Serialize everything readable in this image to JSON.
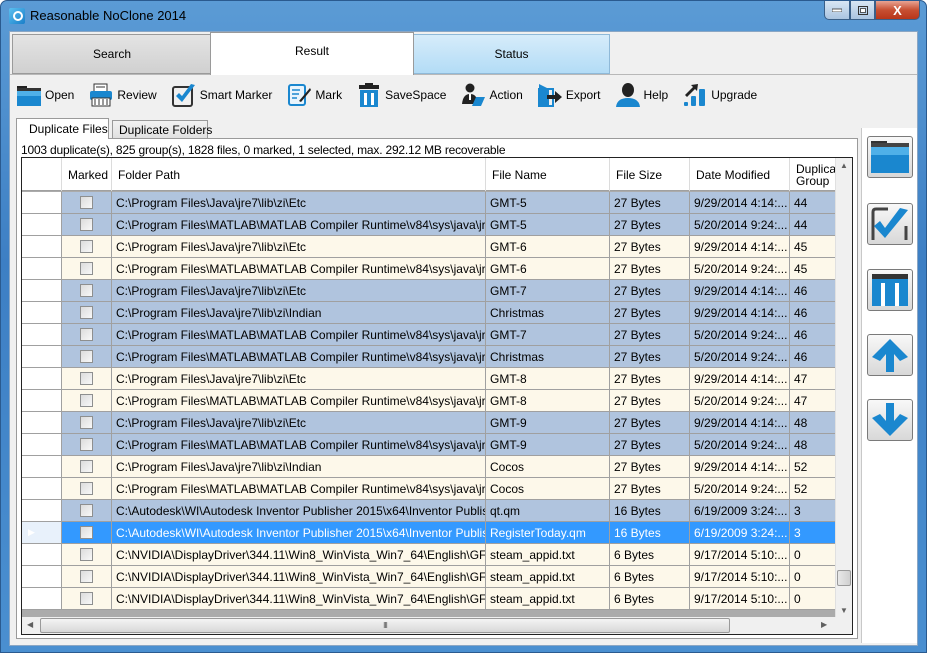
{
  "window": {
    "title": "Reasonable NoClone  2014",
    "controls": {
      "minimize": "—",
      "maximize": "▫",
      "close": "X"
    }
  },
  "main_tabs": [
    {
      "label": "Search",
      "active": false
    },
    {
      "label": "Result",
      "active": true
    },
    {
      "label": "Status",
      "active": false
    }
  ],
  "toolbar": [
    {
      "label": "Open",
      "icon": "folder-icon"
    },
    {
      "label": "Review",
      "icon": "review-icon"
    },
    {
      "label": "Smart Marker",
      "icon": "checkmark-icon"
    },
    {
      "label": "Mark",
      "icon": "pen-icon"
    },
    {
      "label": "SaveSpace",
      "icon": "trash-icon"
    },
    {
      "label": "Action",
      "icon": "person-laptop-icon"
    },
    {
      "label": "Export",
      "icon": "export-icon"
    },
    {
      "label": "Help",
      "icon": "person-icon"
    },
    {
      "label": "Upgrade",
      "icon": "upgrade-icon"
    }
  ],
  "sub_tabs": [
    {
      "label": "Duplicate Files",
      "active": true
    },
    {
      "label": "Duplicate Folders",
      "active": false
    }
  ],
  "summary": "1003 duplicate(s), 825 group(s), 1828 files, 0 marked, 1 selected, max. 292.12 MB recoverable",
  "grid": {
    "columns": [
      "Marked",
      "Folder Path",
      "File Name",
      "File Size",
      "Date Modified",
      "Duplica Group"
    ],
    "rows": [
      {
        "style": "blue",
        "marked": false,
        "folder": "C:\\Program Files\\Java\\jre7\\lib\\zi\\Etc",
        "name": "GMT-5",
        "size": "27 Bytes",
        "date": "9/29/2014 4:14:...",
        "group": "44"
      },
      {
        "style": "blue",
        "marked": false,
        "folder": "C:\\Program Files\\MATLAB\\MATLAB Compiler Runtime\\v84\\sys\\java\\jre\\w...",
        "name": "GMT-5",
        "size": "27 Bytes",
        "date": "5/20/2014 9:24:...",
        "group": "44"
      },
      {
        "style": "cream",
        "marked": false,
        "folder": "C:\\Program Files\\Java\\jre7\\lib\\zi\\Etc",
        "name": "GMT-6",
        "size": "27 Bytes",
        "date": "9/29/2014 4:14:...",
        "group": "45"
      },
      {
        "style": "cream",
        "marked": false,
        "folder": "C:\\Program Files\\MATLAB\\MATLAB Compiler Runtime\\v84\\sys\\java\\jre\\w...",
        "name": "GMT-6",
        "size": "27 Bytes",
        "date": "5/20/2014 9:24:...",
        "group": "45"
      },
      {
        "style": "blue",
        "marked": false,
        "folder": "C:\\Program Files\\Java\\jre7\\lib\\zi\\Etc",
        "name": "GMT-7",
        "size": "27 Bytes",
        "date": "9/29/2014 4:14:...",
        "group": "46"
      },
      {
        "style": "blue",
        "marked": false,
        "folder": "C:\\Program Files\\Java\\jre7\\lib\\zi\\Indian",
        "name": "Christmas",
        "size": "27 Bytes",
        "date": "9/29/2014 4:14:...",
        "group": "46"
      },
      {
        "style": "blue",
        "marked": false,
        "folder": "C:\\Program Files\\MATLAB\\MATLAB Compiler Runtime\\v84\\sys\\java\\jre\\w...",
        "name": "GMT-7",
        "size": "27 Bytes",
        "date": "5/20/2014 9:24:...",
        "group": "46"
      },
      {
        "style": "blue",
        "marked": false,
        "folder": "C:\\Program Files\\MATLAB\\MATLAB Compiler Runtime\\v84\\sys\\java\\jre\\w...",
        "name": "Christmas",
        "size": "27 Bytes",
        "date": "5/20/2014 9:24:...",
        "group": "46"
      },
      {
        "style": "cream",
        "marked": false,
        "folder": "C:\\Program Files\\Java\\jre7\\lib\\zi\\Etc",
        "name": "GMT-8",
        "size": "27 Bytes",
        "date": "9/29/2014 4:14:...",
        "group": "47"
      },
      {
        "style": "cream",
        "marked": false,
        "folder": "C:\\Program Files\\MATLAB\\MATLAB Compiler Runtime\\v84\\sys\\java\\jre\\w...",
        "name": "GMT-8",
        "size": "27 Bytes",
        "date": "5/20/2014 9:24:...",
        "group": "47"
      },
      {
        "style": "blue",
        "marked": false,
        "folder": "C:\\Program Files\\Java\\jre7\\lib\\zi\\Etc",
        "name": "GMT-9",
        "size": "27 Bytes",
        "date": "9/29/2014 4:14:...",
        "group": "48"
      },
      {
        "style": "blue",
        "marked": false,
        "folder": "C:\\Program Files\\MATLAB\\MATLAB Compiler Runtime\\v84\\sys\\java\\jre\\w...",
        "name": "GMT-9",
        "size": "27 Bytes",
        "date": "5/20/2014 9:24:...",
        "group": "48"
      },
      {
        "style": "cream",
        "marked": false,
        "folder": "C:\\Program Files\\Java\\jre7\\lib\\zi\\Indian",
        "name": "Cocos",
        "size": "27 Bytes",
        "date": "9/29/2014 4:14:...",
        "group": "52"
      },
      {
        "style": "cream",
        "marked": false,
        "folder": "C:\\Program Files\\MATLAB\\MATLAB Compiler Runtime\\v84\\sys\\java\\jre\\w...",
        "name": "Cocos",
        "size": "27 Bytes",
        "date": "5/20/2014 9:24:...",
        "group": "52"
      },
      {
        "style": "blue",
        "marked": false,
        "folder": "C:\\Autodesk\\WI\\Autodesk Inventor Publisher 2015\\x64\\Inventor Publisher...",
        "name": "qt.qm",
        "size": "16 Bytes",
        "date": "6/19/2009 3:24:...",
        "group": "3"
      },
      {
        "style": "sel",
        "marked": false,
        "current": true,
        "folder": "C:\\Autodesk\\WI\\Autodesk Inventor Publisher 2015\\x64\\Inventor Publisher...",
        "name": "RegisterToday.qm",
        "size": "16 Bytes",
        "date": "6/19/2009 3:24:...",
        "group": "3"
      },
      {
        "style": "cream",
        "marked": false,
        "folder": "C:\\NVIDIA\\DisplayDriver\\344.11\\Win8_WinVista_Win7_64\\English\\GFEx...",
        "name": "steam_appid.txt",
        "size": "6 Bytes",
        "date": "9/17/2014 5:10:...",
        "group": "0"
      },
      {
        "style": "cream",
        "marked": false,
        "folder": "C:\\NVIDIA\\DisplayDriver\\344.11\\Win8_WinVista_Win7_64\\English\\GFEx...",
        "name": "steam_appid.txt",
        "size": "6 Bytes",
        "date": "9/17/2014 5:10:...",
        "group": "0"
      },
      {
        "style": "cream",
        "marked": false,
        "folder": "C:\\NVIDIA\\DisplayDriver\\344.11\\Win8_WinVista_Win7_64\\English\\GFEx...",
        "name": "steam_appid.txt",
        "size": "6 Bytes",
        "date": "9/17/2014 5:10:...",
        "group": "0"
      }
    ]
  },
  "scrollbars": {
    "hscroll_grip": "III",
    "current_row_marker": "▶"
  },
  "side_buttons": [
    {
      "name": "open-folder",
      "icon": "folder-icon"
    },
    {
      "name": "smart-marker",
      "icon": "checkmark-icon"
    },
    {
      "name": "savespace",
      "icon": "trash-icon"
    },
    {
      "name": "move-up",
      "icon": "arrow-up-icon"
    },
    {
      "name": "move-down",
      "icon": "arrow-down-icon"
    }
  ],
  "colors": {
    "row_group_a": "#b0c4de",
    "row_group_b": "#fdf8ea",
    "row_selected": "#3399ff",
    "icon_blue": "#1a87cf"
  }
}
